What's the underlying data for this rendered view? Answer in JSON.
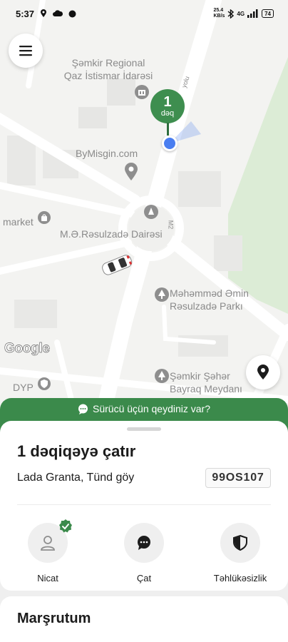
{
  "status_bar": {
    "time": "5:37",
    "net_speed_value": "25.4",
    "net_speed_unit": "KB/s",
    "network": "4G",
    "battery": "74"
  },
  "map": {
    "labels": {
      "poi_1_line1": "Şəmkir Regional",
      "poi_1_line2": "Qaz İstismar İdarəsi",
      "poi_2": "ByMisgin.com",
      "poi_3": "market",
      "poi_4": "M.Ə.Rəsulzadə Dairəsi",
      "poi_5_line1": "Məhəmməd Əmin",
      "poi_5_line2": "Rəsulzadə Parkı",
      "poi_6_line1": "Şəmkir Şəhər",
      "poi_6_line2": "Bayraq Meydanı",
      "poi_7": "DYP",
      "road_1": "yolu",
      "road_2": "M2"
    },
    "eta_pin": {
      "number": "1",
      "unit": "dəq"
    },
    "attribution": "Google"
  },
  "note_banner": {
    "label": "Sürücü üçün qeydiniz var?"
  },
  "ride": {
    "arrival": "1 dəqiqəyə çatır",
    "car": "Lada Granta, Tünd göy",
    "plate": "99OS107"
  },
  "actions": [
    {
      "label": "Nicat",
      "icon": "driver-avatar-icon"
    },
    {
      "label": "Çat",
      "icon": "chat-icon"
    },
    {
      "label": "Təhlükəsizlik",
      "icon": "shield-icon"
    }
  ],
  "route": {
    "title": "Marşrutum"
  },
  "colors": {
    "accent_green": "#3b8a4b",
    "user_dot": "#4a7ef0",
    "park_green": "#dcecd6"
  }
}
